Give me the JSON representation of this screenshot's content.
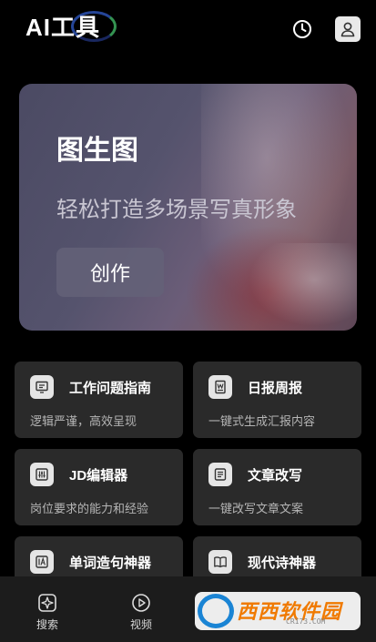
{
  "header": {
    "title": "AI工具"
  },
  "hero": {
    "title": "图生图",
    "subtitle": "轻松打造多场景写真形象",
    "button_label": "创作"
  },
  "cards": [
    {
      "title": "工作问题指南",
      "desc": "逻辑严谨，高效呈现",
      "icon": "monitor-icon"
    },
    {
      "title": "日报周报",
      "desc": "一键式生成汇报内容",
      "icon": "word-doc-icon"
    },
    {
      "title": "JD编辑器",
      "desc": "岗位要求的能力和经验",
      "icon": "sliders-icon"
    },
    {
      "title": "文章改写",
      "desc": "一键改写文章文案",
      "icon": "document-icon"
    },
    {
      "title": "单词造句神器",
      "desc": "",
      "icon": "letter-a-icon"
    },
    {
      "title": "现代诗神器",
      "desc": "",
      "icon": "book-icon"
    }
  ],
  "bottom_nav": [
    {
      "label": "搜索",
      "icon": "search-sparkle-icon"
    },
    {
      "label": "视频",
      "icon": "play-circle-icon"
    }
  ],
  "watermark": {
    "brand": "西西软件园",
    "url": "CR173.COM"
  }
}
